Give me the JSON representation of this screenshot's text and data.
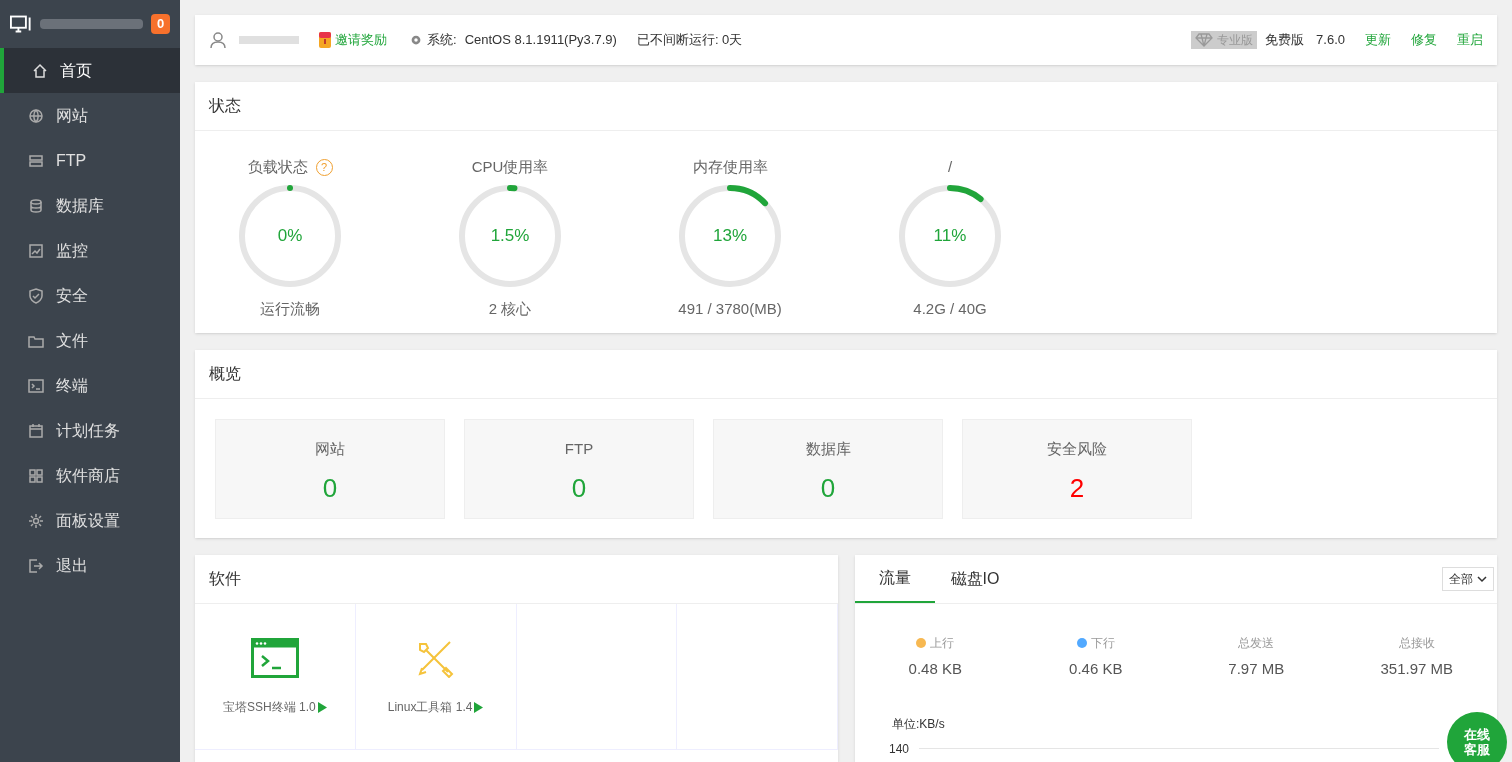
{
  "sidebar": {
    "badge": "0",
    "items": [
      {
        "label": "首页",
        "kind": "home",
        "selected": true
      },
      {
        "label": "网站",
        "kind": "globe",
        "selected": false
      },
      {
        "label": "FTP",
        "kind": "ftp",
        "selected": false
      },
      {
        "label": "数据库",
        "kind": "db",
        "selected": false
      },
      {
        "label": "监控",
        "kind": "monitor",
        "selected": false
      },
      {
        "label": "安全",
        "kind": "shield",
        "selected": false
      },
      {
        "label": "文件",
        "kind": "folder",
        "selected": false
      },
      {
        "label": "终端",
        "kind": "terminal",
        "selected": false
      },
      {
        "label": "计划任务",
        "kind": "calendar",
        "selected": false
      },
      {
        "label": "软件商店",
        "kind": "grid",
        "selected": false
      },
      {
        "label": "面板设置",
        "kind": "gear",
        "selected": false
      },
      {
        "label": "退出",
        "kind": "logout",
        "selected": false
      }
    ]
  },
  "header": {
    "invite": "邀请奖励",
    "system_label": "系统:",
    "system": "CentOS 8.1.1911(Py3.7.9)",
    "uptime": "已不间断运行: 0天",
    "pro_badge": "专业版",
    "edition": "免费版",
    "version": "7.6.0",
    "actions": [
      "更新",
      "修复",
      "重启"
    ]
  },
  "status": {
    "title": "状态",
    "gauges": [
      {
        "label": "负载状态",
        "help": "?",
        "value": "0%",
        "level": 0,
        "caption": "运行流畅"
      },
      {
        "label": "CPU使用率",
        "value": "1.5%",
        "level": 0.015,
        "caption": "2 核心"
      },
      {
        "label": "内存使用率",
        "value": "13%",
        "level": 0.13,
        "caption": "491 / 3780(MB)"
      },
      {
        "label": "/",
        "value": "11%",
        "level": 0.11,
        "caption": "4.2G / 40G"
      }
    ]
  },
  "overview": {
    "title": "概览",
    "cards": [
      {
        "label": "网站",
        "value": "0",
        "color": "#20a53a"
      },
      {
        "label": "FTP",
        "value": "0",
        "color": "#20a53a"
      },
      {
        "label": "数据库",
        "value": "0",
        "color": "#20a53a"
      },
      {
        "label": "安全风险",
        "value": "2",
        "color": "#ff0000"
      }
    ]
  },
  "software": {
    "title": "软件",
    "items": [
      {
        "name": "宝塔SSH终端 1.0",
        "kind": "terminal"
      },
      {
        "name": "Linux工具箱 1.4",
        "kind": "tools"
      }
    ]
  },
  "traffic": {
    "tabs": [
      {
        "label": "流量",
        "selected": true
      },
      {
        "label": "磁盘IO",
        "selected": false
      }
    ],
    "select": "全部",
    "stats": [
      {
        "label": "上行",
        "value": "0.48 KB",
        "color": "#f7b851"
      },
      {
        "label": "下行",
        "value": "0.46 KB",
        "color": "#52a9ff"
      },
      {
        "label": "总发送",
        "value": "7.97 MB"
      },
      {
        "label": "总接收",
        "value": "351.97 MB"
      }
    ],
    "unit": "单位:KB/s",
    "tick": "140"
  },
  "chat_button": [
    "在线",
    "客服"
  ]
}
